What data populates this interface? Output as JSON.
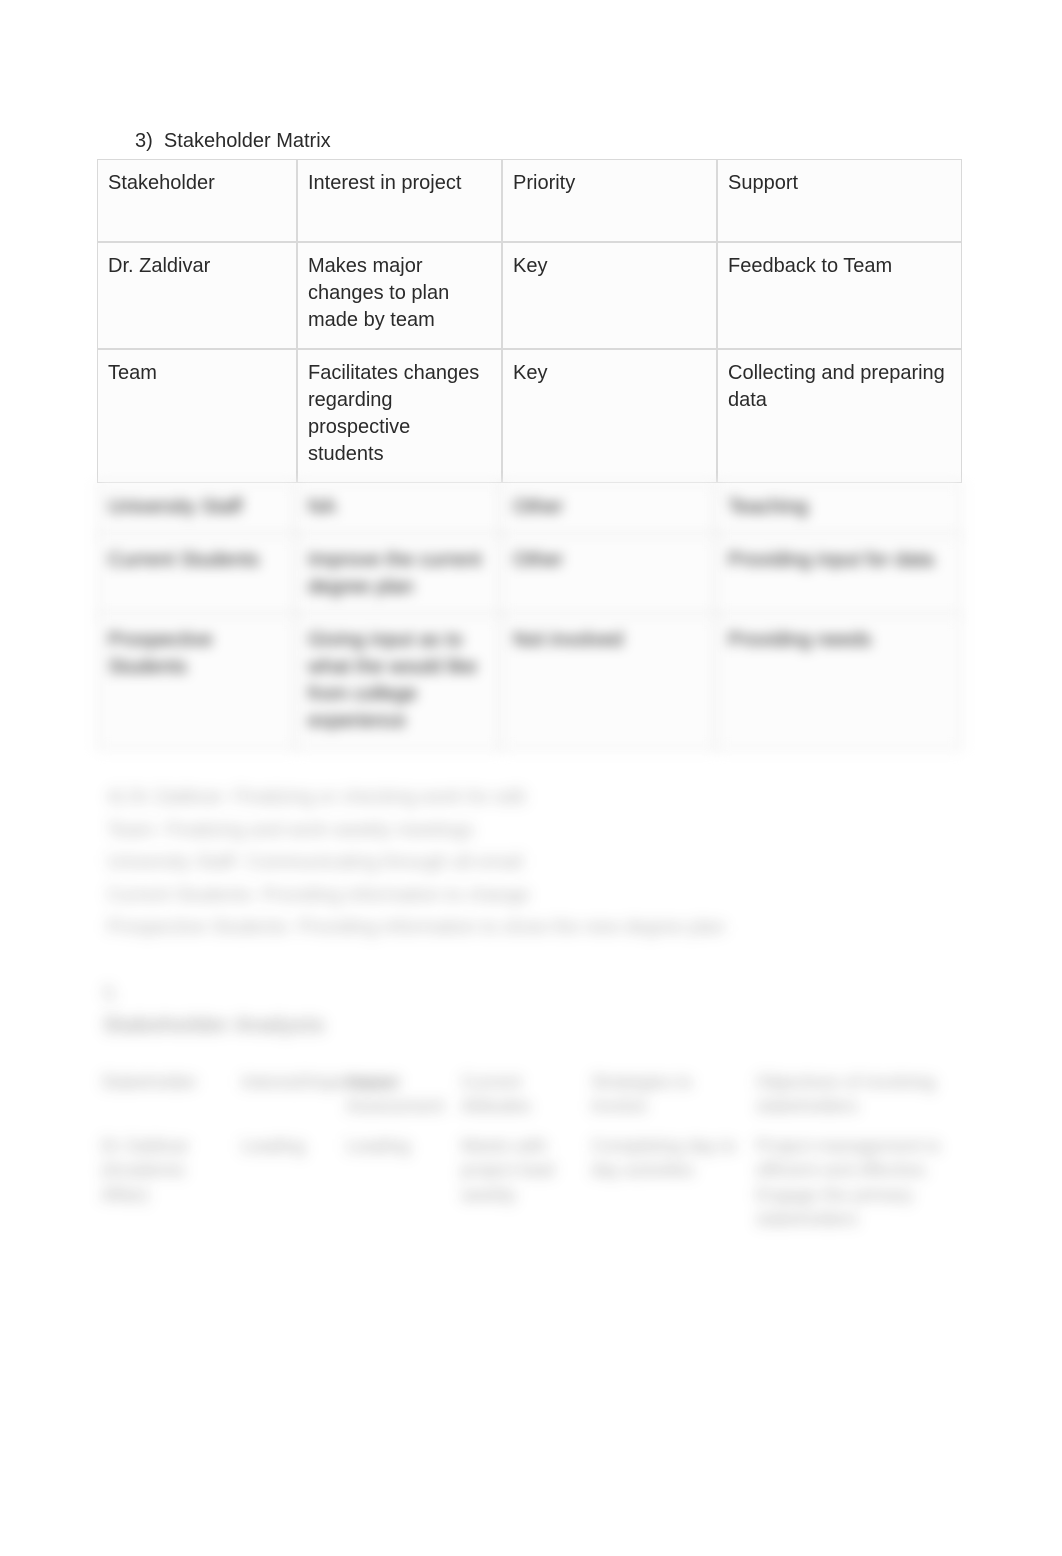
{
  "section": {
    "number": "3)",
    "title": "Stakeholder Matrix"
  },
  "table1": {
    "headers": [
      "Stakeholder",
      "Interest in project",
      "Priority",
      "Support"
    ],
    "rows": [
      {
        "c0": "Dr. Zaldivar",
        "c1": "Makes major changes to plan made by team",
        "c2": "Key",
        "c3": "Feedback to Team"
      },
      {
        "c0": "Team",
        "c1": "Facilitates changes regarding prospective students",
        "c2": "Key",
        "c3": "Collecting and preparing data"
      },
      {
        "c0": "University Staff",
        "c1": "NA",
        "c2": "Other",
        "c3": "Teaching"
      },
      {
        "c0": "Current Students",
        "c1": "Improve the current degree plan",
        "c2": "Other",
        "c3": "Providing input for data"
      },
      {
        "c0": "Prospective Students",
        "c1": "Giving input as to what the would like from college experience",
        "c2": "Not involved",
        "c3": "Providing needs"
      }
    ]
  },
  "blurred_paragraph_lines": [
    "4) Dr Zaldivar- Finalizing or checking work for edit",
    "Team- Finalizing and work weekly meetings",
    "University Staff- Communicating through all email",
    "Current Students- Providing information to change",
    "Prospective Students- Providing information to show the new degree plan"
  ],
  "blurred_number": "5.",
  "blurred_heading": "Stakeholder Analysis",
  "table2": {
    "headers": [
      "Stakeholder",
      "Interest/Importance",
      "Impact Assessment",
      "Current Attitudes",
      "Strategies to involve",
      "Objectives of involving stakeholders"
    ],
    "rows": [
      {
        "c0": "Dr Zaldivar (Academic Affair)",
        "c1": "Leading",
        "c2": "Leading",
        "c3": "Meets with project lead weekly",
        "c4": "Completing day to day activities",
        "c5": "Project management is efficient and effective. Engage the primary stakeholders"
      }
    ]
  }
}
